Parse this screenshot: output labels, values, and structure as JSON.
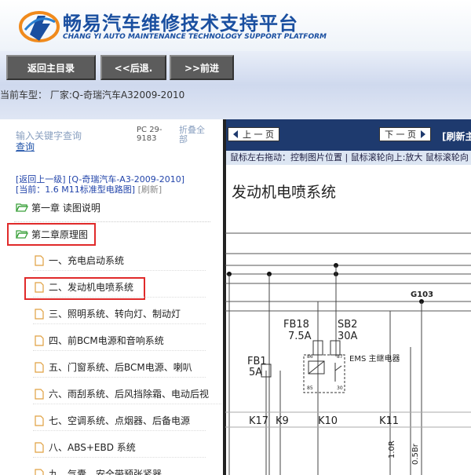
{
  "header": {
    "title_cn": "畅易汽车维修技术支持平台",
    "title_en": "CHANG YI AUTO MAINTENANCE TECHNOLOGY SUPPORT PLATFORM",
    "logo_icon": "cy-logo-icon"
  },
  "nav": {
    "home": "返回主目录",
    "back": "<<后退.",
    "forward": ">>前进"
  },
  "vehicle": "当前车型： 厂家:Q-奇瑞汽车A32009-2010",
  "search": {
    "placeholder": "输入关键字查询",
    "button": "查询",
    "pc_label": "PC 29-9183",
    "collapse": "折叠全部"
  },
  "breadcrumb": {
    "up": "[返回上一级]",
    "model": "[Q-奇瑞汽车-A3-2009-2010]",
    "current_prefix": "[当前：",
    "current_name": "1.6 M11标准型电路图",
    "current_suffix": "]",
    "refresh": "[刷新]"
  },
  "tree": {
    "ch1": "第一章 读图说明",
    "ch2": "第二章原理图",
    "items": [
      "一、充电启动系统",
      "二、发动机电喷系统",
      "三、照明系统、转向灯、制动灯",
      "四、前BCM电源和音响系统",
      "五、门窗系统、后BCM电源、喇叭",
      "六、雨刮系统、后风挡除霜、电动后视",
      "七、空调系统、点烟器、后备电源",
      "八、ABS+EBD 系统",
      "九、气囊、安全带预张紧器"
    ]
  },
  "viewer": {
    "prev": "上 一 页",
    "next": "下 一 页",
    "refresh": "[刷新主",
    "hint": "鼠标左右拖动：控制图片位置 | 鼠标滚轮向上:放大  鼠标滚轮向",
    "title": "发动机电喷系统",
    "labels": {
      "g103": "G103",
      "fb18": "FB18",
      "fb18_val": "7.5A",
      "sb2": "SB2",
      "sb2_val": "30A",
      "fb1": "FB1",
      "fb1_val": "5A",
      "ems": "EMS 主继电器",
      "p86": "86",
      "p85": "85",
      "p87": "87",
      "p30": "30",
      "k17": "K17",
      "k9": "K9",
      "k10": "K10",
      "k11": "K11",
      "w1": "1.0R",
      "w2": "0.5Br"
    }
  },
  "colors": {
    "brand": "#1a4fa0",
    "nav_button": "#5c5c5c",
    "viewer_bar": "#1e3a6e",
    "highlight": "#e02a2a",
    "folder": "#3aa03a"
  }
}
